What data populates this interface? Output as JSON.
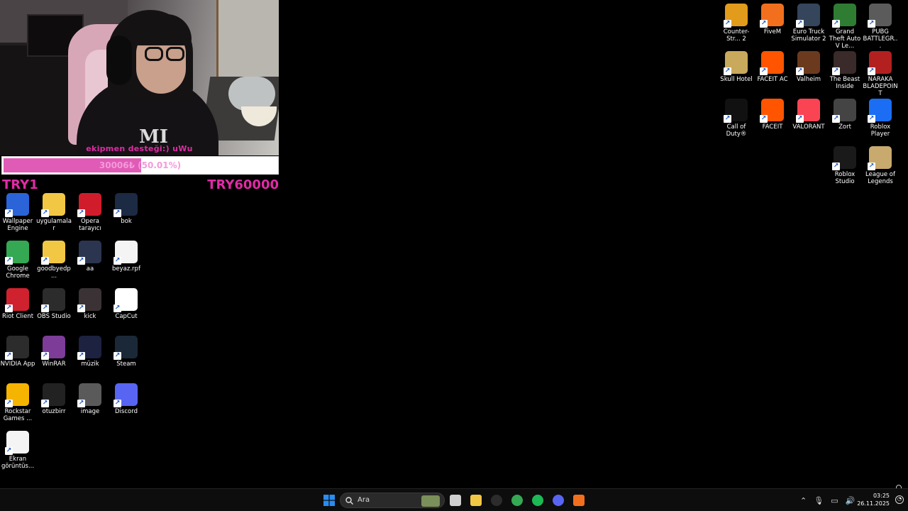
{
  "overlay": {
    "caption": "ekipmen desteği:) uWu",
    "goal_text": "30006₺ (50.01%)",
    "goal_progress": 0.5001,
    "goal_start": "TRY1",
    "goal_end": "TRY60000",
    "accent_color": "#e12aa6"
  },
  "desktop_left": [
    {
      "label": "Wallpaper Engine",
      "icon": "wallpaper-engine-icon",
      "color": "#2a64d8"
    },
    {
      "label": "uygulamalar",
      "icon": "folder-icon",
      "color": "#f2c744"
    },
    {
      "label": "Opera tarayıcı",
      "icon": "opera-icon",
      "color": "#d11c2c"
    },
    {
      "label": "bok",
      "icon": "image-file-icon",
      "color": "#1d2a44"
    },
    {
      "label": "Google Chrome",
      "icon": "chrome-icon",
      "color": "#34a853"
    },
    {
      "label": "goodbyedp...",
      "icon": "folder-icon",
      "color": "#f2c744"
    },
    {
      "label": "aa",
      "icon": "image-file-icon",
      "color": "#2b3550"
    },
    {
      "label": "beyaz.rpf",
      "icon": "document-icon",
      "color": "#f4f4f4"
    },
    {
      "label": "Riot Client",
      "icon": "riot-client-icon",
      "color": "#d0222e"
    },
    {
      "label": "OBS Studio",
      "icon": "obs-icon",
      "color": "#2c2c2c"
    },
    {
      "label": "kick",
      "icon": "image-file-icon",
      "color": "#3a3234"
    },
    {
      "label": "CapCut",
      "icon": "capcut-icon",
      "color": "#ffffff"
    },
    {
      "label": "NVIDIA App",
      "icon": "nvidia-icon",
      "color": "#2c2c2c"
    },
    {
      "label": "WinRAR",
      "icon": "winrar-icon",
      "color": "#7d3c98"
    },
    {
      "label": "müzik",
      "icon": "image-file-icon",
      "color": "#1c2240"
    },
    {
      "label": "Steam",
      "icon": "steam-icon",
      "color": "#1b2838"
    },
    {
      "label": "Rockstar Games ...",
      "icon": "rockstar-icon",
      "color": "#f5b400"
    },
    {
      "label": "otuzbirr",
      "icon": "image-file-icon",
      "color": "#222"
    },
    {
      "label": "image",
      "icon": "image-file-icon",
      "color": "#5a5a5a"
    },
    {
      "label": "Discord",
      "icon": "discord-icon",
      "color": "#5865f2"
    },
    {
      "label": "Ekran görüntüs...",
      "icon": "screenshot-file-icon",
      "color": "#f4f4f4"
    }
  ],
  "desktop_right": [
    {
      "label": "Counter-Str... 2",
      "icon": "cs2-icon",
      "color": "#e39b1c"
    },
    {
      "label": "FiveM",
      "icon": "fivem-icon",
      "color": "#f2701d"
    },
    {
      "label": "Euro Truck Simulator 2",
      "icon": "ets2-icon",
      "color": "#34455c"
    },
    {
      "label": "Grand Theft Auto V Le...",
      "icon": "gta5-icon",
      "color": "#2f7d32"
    },
    {
      "label": "PUBG BATTLEGR...",
      "icon": "pubg-icon",
      "color": "#5b5b5b"
    },
    {
      "label": "Skull Hotel",
      "icon": "skull-hotel-icon",
      "color": "#c9a95c"
    },
    {
      "label": "FACEIT AC",
      "icon": "faceit-ac-icon",
      "color": "#ff5500"
    },
    {
      "label": "Valheim",
      "icon": "valheim-icon",
      "color": "#6b3a1e"
    },
    {
      "label": "The Beast Inside",
      "icon": "beast-inside-icon",
      "color": "#3a2a2a"
    },
    {
      "label": "NARAKA BLADEPOINT",
      "icon": "naraka-icon",
      "color": "#b32020"
    },
    {
      "label": "Call of Duty®",
      "icon": "cod-icon",
      "color": "#111111"
    },
    {
      "label": "FACEIT",
      "icon": "faceit-icon",
      "color": "#ff5500"
    },
    {
      "label": "VALORANT",
      "icon": "valorant-icon",
      "color": "#fa4454"
    },
    {
      "label": "Zort",
      "icon": "zort-icon",
      "color": "#444"
    },
    {
      "label": "Roblox Player",
      "icon": "roblox-player-icon",
      "color": "#1b6ef3"
    },
    {
      "label": "Roblox Studio",
      "icon": "roblox-studio-icon",
      "color": "#1a1a1a"
    },
    {
      "label": "League of Legends",
      "icon": "lol-icon",
      "color": "#c8aa6e"
    }
  ],
  "taskbar": {
    "search_placeholder": "Ara",
    "apps": [
      {
        "name": "start-button",
        "icon": "windows-logo-icon",
        "color": "#2a8cf0"
      },
      {
        "name": "task-view-button",
        "icon": "task-view-icon",
        "color": "#cfcfcf"
      },
      {
        "name": "taskbar-store",
        "icon": "store-icon",
        "color": "#f2c744"
      },
      {
        "name": "taskbar-obs",
        "icon": "obs-icon",
        "color": "#2c2c2c"
      },
      {
        "name": "taskbar-chrome",
        "icon": "chrome-icon",
        "color": "#34a853"
      },
      {
        "name": "taskbar-spotify",
        "icon": "spotify-icon",
        "color": "#1db954"
      },
      {
        "name": "taskbar-discord",
        "icon": "discord-icon",
        "color": "#5865f2"
      },
      {
        "name": "taskbar-fivem",
        "icon": "fivem-icon",
        "color": "#f2701d"
      }
    ],
    "time": "03:25",
    "date": "26.11.2025"
  }
}
